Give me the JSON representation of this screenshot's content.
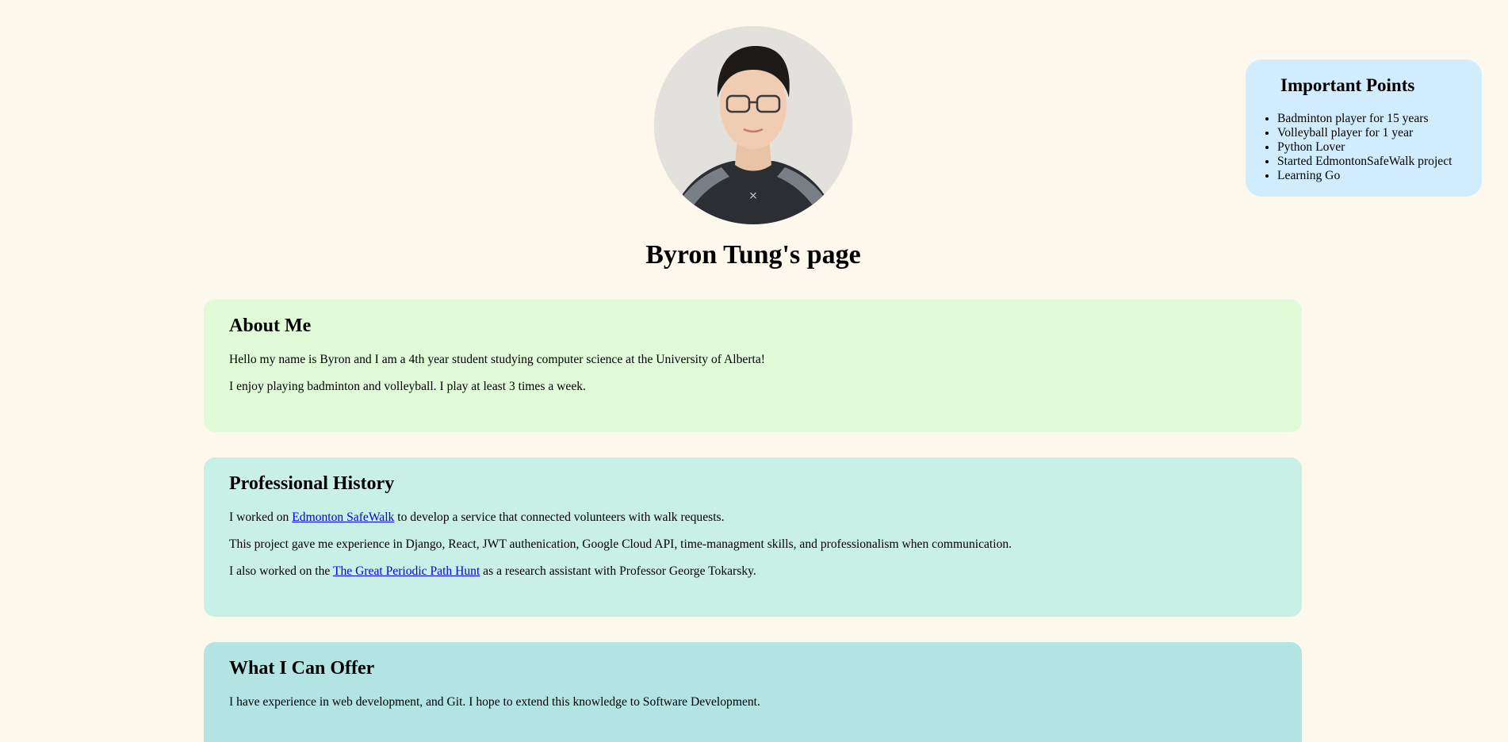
{
  "profile": {
    "photo_icon": "profile-photo",
    "title": "Byron Tung's page"
  },
  "important_points": {
    "heading": "Important Points",
    "items": [
      "Badminton player for 15 years",
      "Volleyball player for 1 year",
      "Python Lover",
      "Started EdmontonSafeWalk project",
      "Learning Go"
    ]
  },
  "about": {
    "heading": "About Me",
    "p1": "Hello my name is Byron and I am a 4th year student studying computer science at the University of Alberta!",
    "p2": "I enjoy playing badminton and volleyball. I play at least 3 times a week."
  },
  "history": {
    "heading": "Professional History",
    "p1_before": "I worked on ",
    "p1_link": "Edmonton SafeWalk",
    "p1_after": " to develop a service that connected volunteers with walk requests.",
    "p2": "This project gave me experience in Django, React, JWT authenication, Google Cloud API, time-managment skills, and professionalism when communication.",
    "p3_before": "I also worked on the ",
    "p3_link": "The Great Periodic Path Hunt",
    "p3_after": " as a research assistant with Professor George Tokarsky."
  },
  "offer": {
    "heading": "What I Can Offer",
    "p1": "I have experience in web development, and Git. I hope to extend this knowledge to Software Development."
  },
  "colors": {
    "page_bg": "#fcf9ec",
    "important_bg": "#d1ecfd",
    "about_bg": "#e1fbd9",
    "history_bg": "#c8f0e6",
    "offer_bg": "#b3e4e4",
    "link": "#0000ee"
  }
}
